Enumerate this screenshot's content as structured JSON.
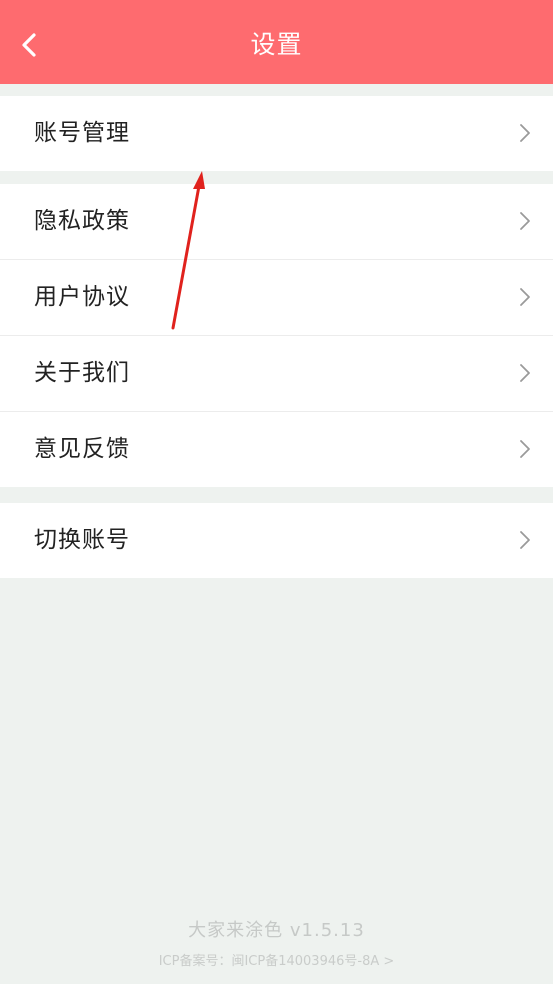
{
  "header": {
    "title": "设置",
    "back_icon": "chevron-left-icon"
  },
  "groups": [
    {
      "items": [
        {
          "label": "账号管理"
        }
      ]
    },
    {
      "items": [
        {
          "label": "隐私政策"
        },
        {
          "label": "用户协议"
        },
        {
          "label": "关于我们"
        },
        {
          "label": "意见反馈"
        }
      ]
    },
    {
      "items": [
        {
          "label": "切换账号"
        }
      ]
    }
  ],
  "footer": {
    "version": "大家来涂色 v1.5.13",
    "icp": "ICP备案号：闽ICP备14003946号-8A >"
  },
  "colors": {
    "header_bg": "#fe6b6f",
    "page_bg": "#eef2ef",
    "annotation_arrow": "#e0221d"
  }
}
